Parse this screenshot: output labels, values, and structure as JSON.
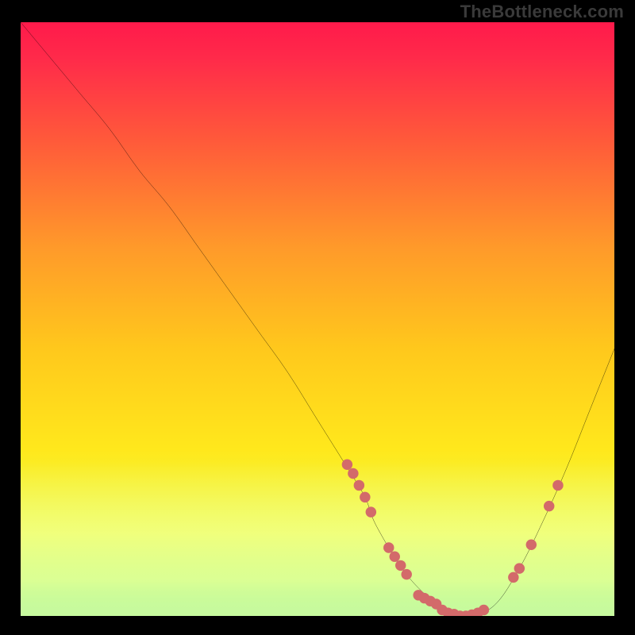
{
  "watermark": {
    "text": "TheBottleneck.com"
  },
  "chart_data": {
    "type": "line",
    "title": "",
    "xlabel": "",
    "ylabel": "",
    "xlim": [
      0,
      100
    ],
    "ylim": [
      0,
      100
    ],
    "grid": false,
    "legend": false,
    "background_gradient": {
      "top": "#ff1a4b",
      "mid": "#ffd400",
      "bottom": "#00e060"
    },
    "bottom_glow_band": {
      "y_range": [
        0,
        24
      ],
      "color": "#f6ff9a"
    },
    "series": [
      {
        "name": "bottleneck-curve",
        "color": "#000000",
        "x": [
          0,
          5,
          10,
          15,
          20,
          25,
          30,
          35,
          40,
          45,
          50,
          55,
          58,
          60,
          65,
          70,
          73,
          76,
          80,
          84,
          88,
          92,
          96,
          100
        ],
        "y": [
          100,
          94,
          88,
          82,
          75,
          69,
          62,
          55,
          48,
          41,
          33,
          25,
          20,
          15,
          7,
          2,
          0,
          0,
          2,
          8,
          16,
          25,
          35,
          45
        ]
      }
    ],
    "markers": {
      "color": "#d36a6a",
      "points": [
        {
          "x": 55.0,
          "y": 25.5
        },
        {
          "x": 56.0,
          "y": 24.0
        },
        {
          "x": 57.0,
          "y": 22.0
        },
        {
          "x": 58.0,
          "y": 20.0
        },
        {
          "x": 59.0,
          "y": 17.5
        },
        {
          "x": 62.0,
          "y": 11.5
        },
        {
          "x": 63.0,
          "y": 10.0
        },
        {
          "x": 64.0,
          "y": 8.5
        },
        {
          "x": 65.0,
          "y": 7.0
        },
        {
          "x": 67.0,
          "y": 3.5
        },
        {
          "x": 68.0,
          "y": 3.0
        },
        {
          "x": 69.0,
          "y": 2.5
        },
        {
          "x": 70.0,
          "y": 2.0
        },
        {
          "x": 71.0,
          "y": 1.0
        },
        {
          "x": 72.0,
          "y": 0.5
        },
        {
          "x": 73.0,
          "y": 0.3
        },
        {
          "x": 74.0,
          "y": 0.0
        },
        {
          "x": 75.0,
          "y": 0.0
        },
        {
          "x": 76.0,
          "y": 0.2
        },
        {
          "x": 77.0,
          "y": 0.5
        },
        {
          "x": 78.0,
          "y": 1.0
        },
        {
          "x": 83.0,
          "y": 6.5
        },
        {
          "x": 84.0,
          "y": 8.0
        },
        {
          "x": 86.0,
          "y": 12.0
        },
        {
          "x": 89.0,
          "y": 18.5
        },
        {
          "x": 90.5,
          "y": 22.0
        }
      ]
    }
  }
}
